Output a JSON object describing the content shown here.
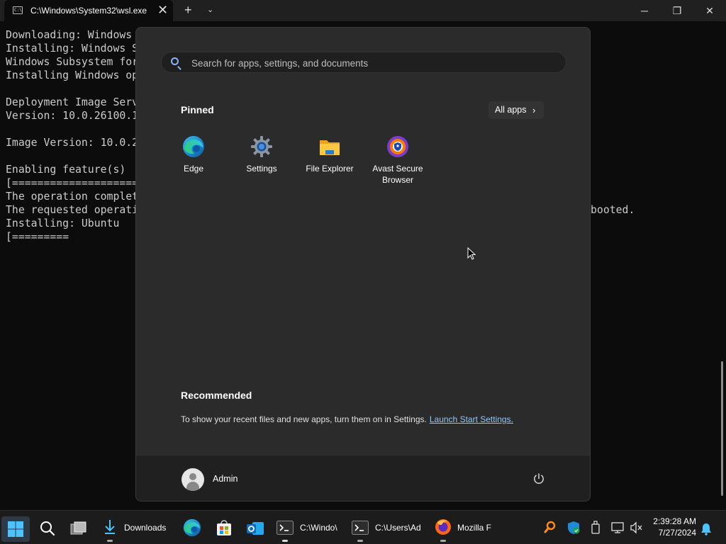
{
  "terminal": {
    "tab_title": "C:\\Windows\\System32\\wsl.exe",
    "new_tab_label": "+",
    "dropdown_label": "⌄",
    "close_tab_label": "✕",
    "minimize_label": "─",
    "restore_label": "❐",
    "close_label": "✕",
    "lines": "Downloading: Windows\nInstalling: Windows S\nWindows Subsystem for\nInstalling Windows op\n\nDeployment Image Serv\nVersion: 10.0.26100.1\n\nImage Version: 10.0.2\n\nEnabling feature(s)\n[====================\nThe operation complet\nThe requested operati\nInstalling: Ubuntu\n[=========",
    "trailing_text": "booted."
  },
  "start_menu": {
    "search_placeholder": "Search for apps, settings, and documents",
    "pinned_heading": "Pinned",
    "all_apps_label": "All apps",
    "all_apps_chevron": "›",
    "pinned_apps": [
      {
        "label": "Edge",
        "icon": "edge-icon"
      },
      {
        "label": "Settings",
        "icon": "settings-gear-icon"
      },
      {
        "label": "File Explorer",
        "icon": "folder-icon"
      },
      {
        "label": "Avast Secure Browser",
        "icon": "avast-browser-icon"
      }
    ],
    "recommended_heading": "Recommended",
    "recommended_text": "To show your recent files and new apps, turn them on in Settings.",
    "recommended_link": "Launch Start Settings.",
    "user_name": "Admin"
  },
  "taskbar": {
    "items": [
      {
        "label": "Downloads"
      },
      {
        "label": "C:\\Windo\\"
      },
      {
        "label": "C:\\Users\\Ad"
      },
      {
        "label": "Mozilla F"
      }
    ],
    "time": "2:39:28 AM",
    "date": "7/27/2024"
  },
  "colors": {
    "accent": "#0078d4",
    "link": "#8ec7ff",
    "start_bg": "#2b2b2b",
    "taskbar_bg": "#1c1c1c"
  }
}
